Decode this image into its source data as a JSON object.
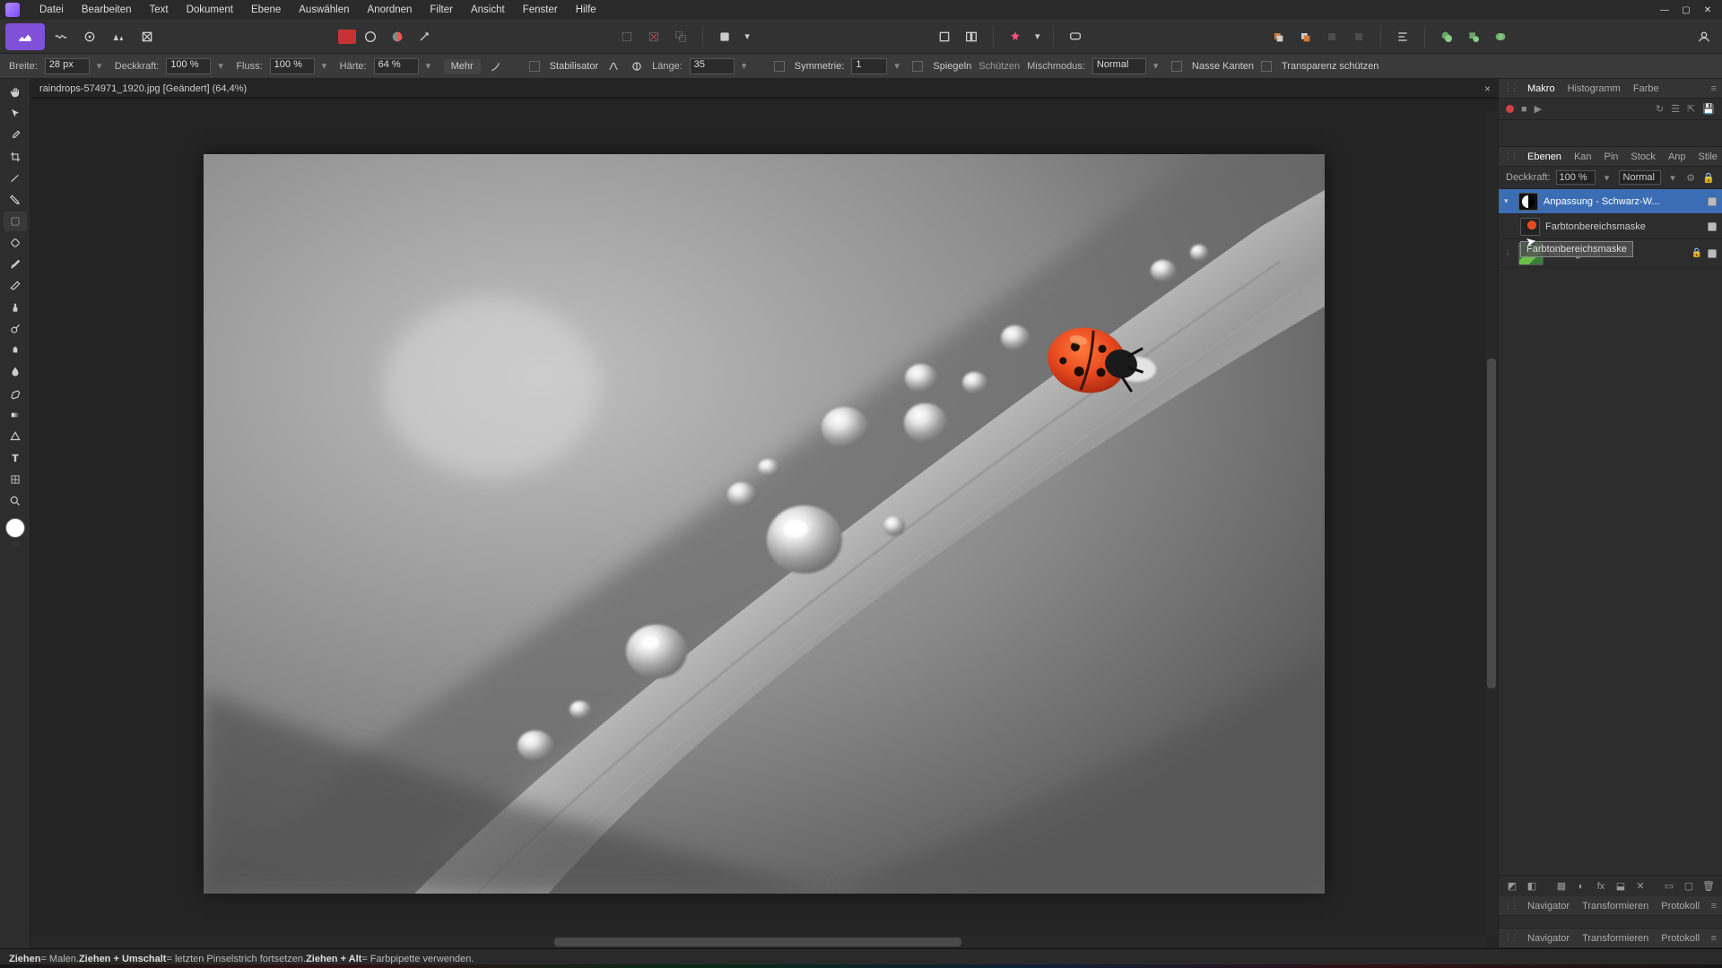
{
  "menu": [
    "Datei",
    "Bearbeiten",
    "Text",
    "Dokument",
    "Ebene",
    "Auswählen",
    "Anordnen",
    "Filter",
    "Ansicht",
    "Fenster",
    "Hilfe"
  ],
  "doc_tab": "raindrops-574971_1920.jpg [Geändert] (64,4%)",
  "context": {
    "breite_label": "Breite:",
    "breite_val": "28 px",
    "deck_label": "Deckkraft:",
    "deck_val": "100 %",
    "fluss_label": "Fluss:",
    "fluss_val": "100 %",
    "haerte_label": "Härte:",
    "haerte_val": "64 %",
    "mehr": "Mehr",
    "stabil": "Stabilisator",
    "laenge_label": "Länge:",
    "laenge_val": "35",
    "symm": "Symmetrie:",
    "symm_val": "1",
    "spiegeln": "Spiegeln",
    "schuetzen": "Schützen",
    "misch_label": "Mischmodus:",
    "misch_val": "Normal",
    "nasse": "Nasse Kanten",
    "transp": "Transparenz schützen"
  },
  "status": {
    "a1": "Ziehen",
    "a1d": " = Malen. ",
    "a2": "Ziehen + Umschalt",
    "a2d": " = letzten Pinselstrich fortsetzen. ",
    "a3": "Ziehen + Alt",
    "a3d": " = Farbpipette verwenden."
  },
  "panel_top": {
    "tabs": [
      "Makro",
      "Histogramm",
      "Farbe"
    ],
    "active": 0
  },
  "panel_layers": {
    "tabs": [
      "Ebenen",
      "Kan",
      "Pin",
      "Stock",
      "Anp",
      "Stile"
    ],
    "active": 0,
    "opacity_label": "Deckkraft:",
    "opacity_val": "100 %",
    "blend": "Normal",
    "layers": [
      {
        "name": "Anpassung - Schwarz-W...",
        "selected": true
      },
      {
        "name": "Farbtonbereichsmaske",
        "child": true
      },
      {
        "name": "Hintergrund",
        "bg": true,
        "locked": true
      }
    ],
    "drag_ghost_text": "Farbtonbereichsmaske"
  },
  "panel_nav1": {
    "tabs": [
      "Navigator",
      "Transformieren",
      "Protokoll"
    ]
  },
  "panel_nav2": {
    "tabs": [
      "Navigator",
      "Transformieren",
      "Protokoll"
    ]
  }
}
